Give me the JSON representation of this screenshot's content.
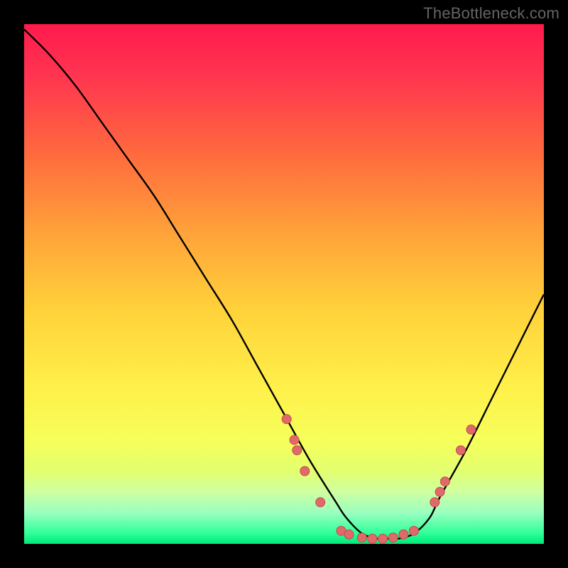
{
  "watermark": "TheBottleneck.com",
  "colors": {
    "background": "#000000",
    "curve": "#000000",
    "marker_fill": "#e06a6a",
    "marker_stroke": "#c84848"
  },
  "chart_data": {
    "type": "line",
    "title": "",
    "xlabel": "",
    "ylabel": "",
    "xlim": [
      0,
      100
    ],
    "ylim": [
      0,
      100
    ],
    "grid": false,
    "series": [
      {
        "name": "bottleneck-curve",
        "x": [
          0,
          5,
          10,
          15,
          20,
          25,
          30,
          35,
          40,
          45,
          50,
          55,
          60,
          62,
          65,
          68,
          70,
          72,
          75,
          78,
          80,
          85,
          90,
          95,
          100
        ],
        "values": [
          99,
          94,
          88,
          81,
          74,
          67,
          59,
          51,
          43,
          34,
          25,
          16,
          8,
          5,
          2,
          1,
          1,
          1,
          2,
          5,
          9,
          18,
          28,
          38,
          48
        ]
      }
    ],
    "markers": [
      {
        "x": 50.5,
        "y": 24
      },
      {
        "x": 52,
        "y": 20
      },
      {
        "x": 52.5,
        "y": 18
      },
      {
        "x": 54,
        "y": 14
      },
      {
        "x": 57,
        "y": 8
      },
      {
        "x": 61,
        "y": 2.5
      },
      {
        "x": 62.5,
        "y": 1.8
      },
      {
        "x": 65,
        "y": 1.2
      },
      {
        "x": 67,
        "y": 1
      },
      {
        "x": 69,
        "y": 1
      },
      {
        "x": 71,
        "y": 1.2
      },
      {
        "x": 73,
        "y": 1.8
      },
      {
        "x": 75,
        "y": 2.5
      },
      {
        "x": 79,
        "y": 8
      },
      {
        "x": 80,
        "y": 10
      },
      {
        "x": 81,
        "y": 12
      },
      {
        "x": 84,
        "y": 18
      },
      {
        "x": 86,
        "y": 22
      }
    ]
  }
}
